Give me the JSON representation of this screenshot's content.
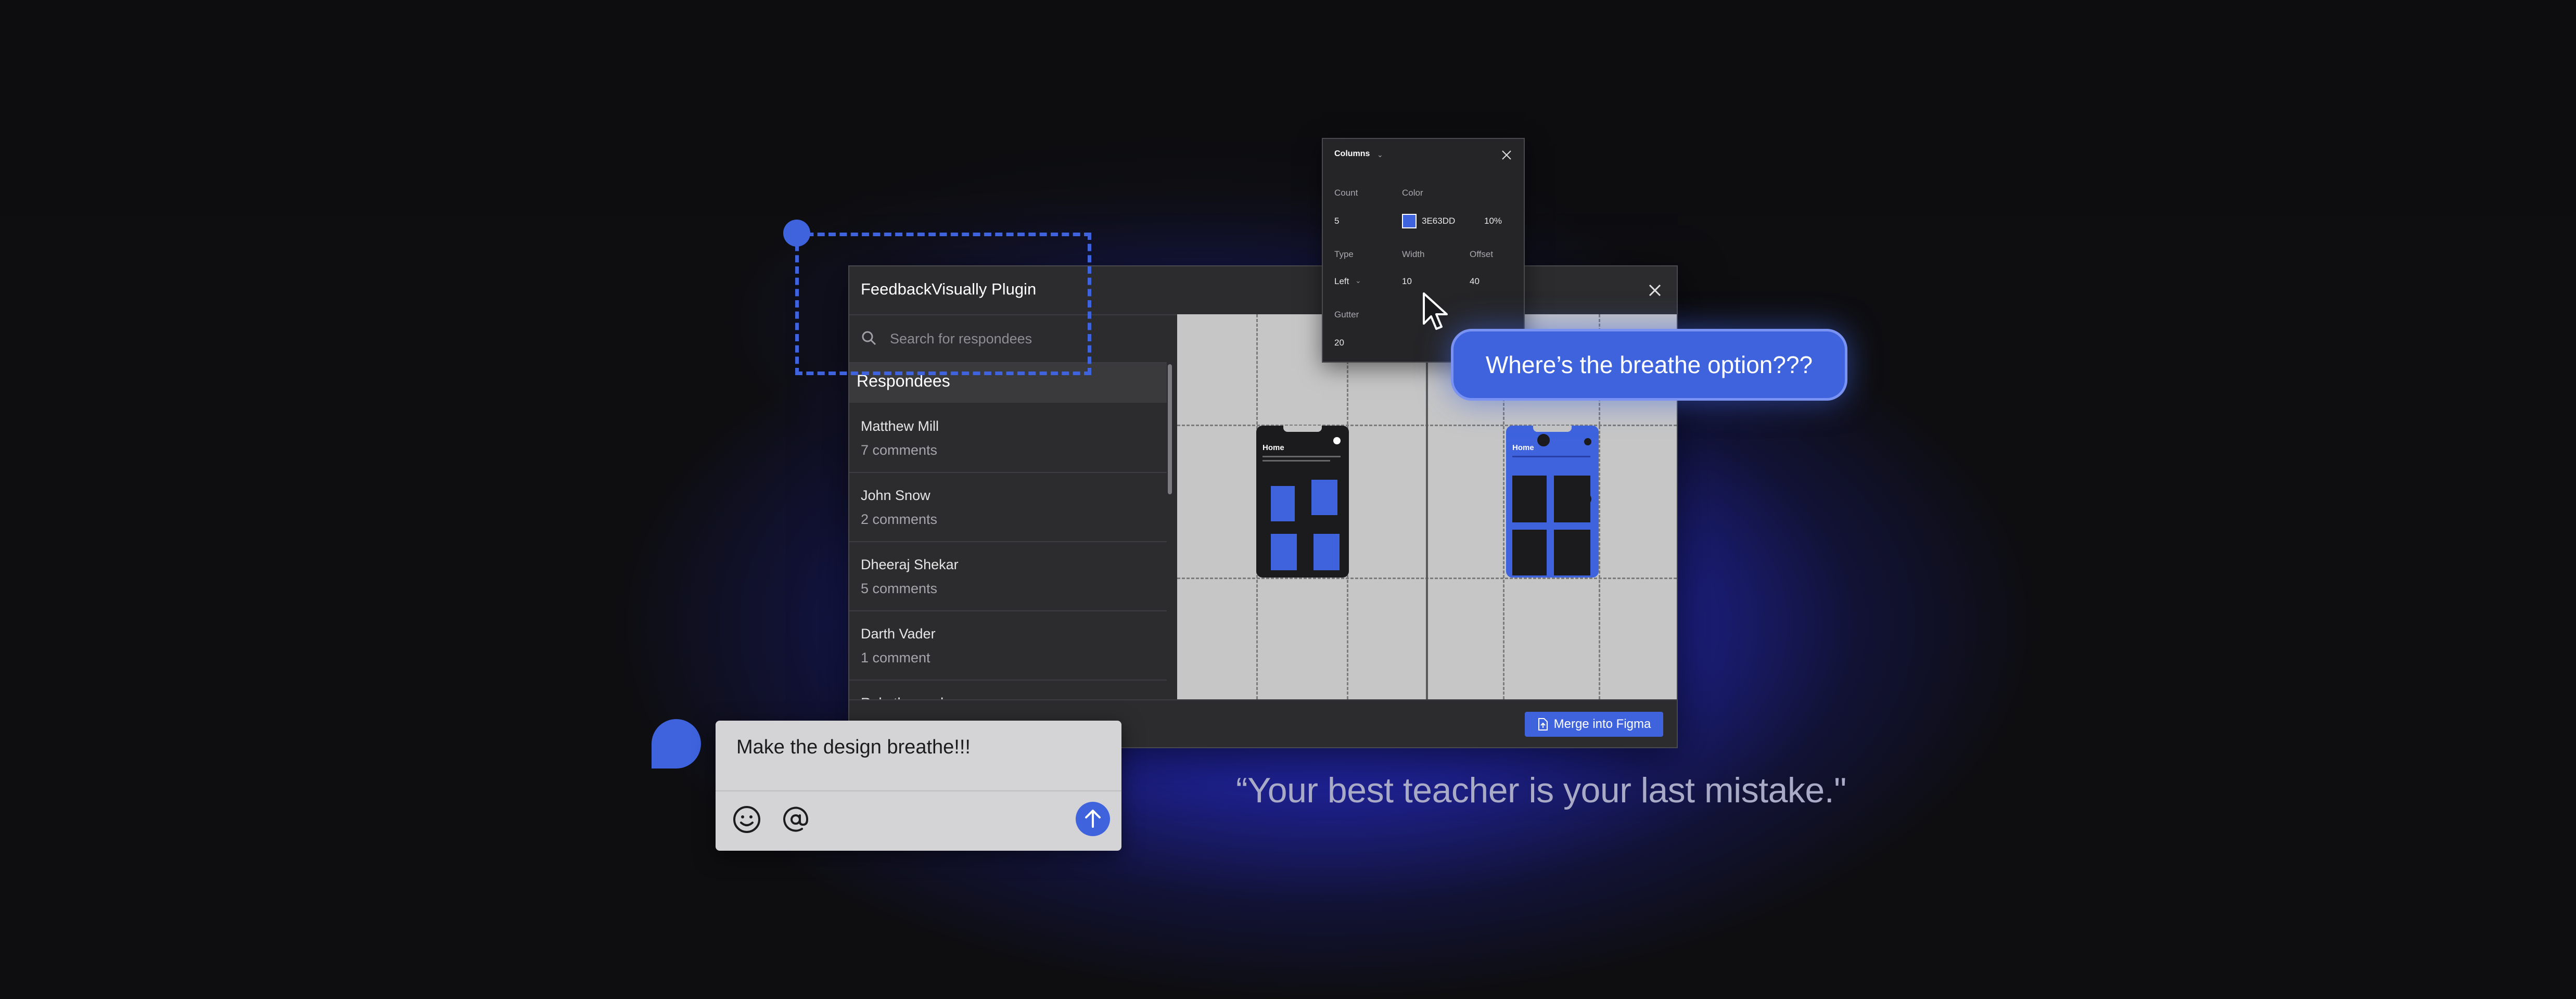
{
  "plugin": {
    "title": "FeedbackVisually Plugin",
    "close_icon": "close-icon",
    "search": {
      "placeholder": "Search for respondees",
      "icon": "search-icon"
    },
    "respondees_heading": "Respondees",
    "respondees": [
      {
        "name": "Matthew Mill",
        "comments": "7 comments"
      },
      {
        "name": "John Snow",
        "comments": "2 comments"
      },
      {
        "name": "Dheeraj Shekar",
        "comments": "5 comments"
      },
      {
        "name": "Darth Vader",
        "comments": "1 comment"
      },
      {
        "name": "Rakotho... ...k...",
        "comments": ""
      }
    ],
    "phones": [
      {
        "title": "Home"
      },
      {
        "title": "Home"
      }
    ],
    "merge_button": "Merge into Figma"
  },
  "columns_popover": {
    "title": "Columns",
    "count_label": "Count",
    "count_value": "5",
    "color_label": "Color",
    "color_hex": "3E63DD",
    "color_opacity": "10%",
    "type_label": "Type",
    "type_value": "Left",
    "width_label": "Width",
    "width_value": "10",
    "offset_label": "Offset",
    "offset_value": "40",
    "gutter_label": "Gutter",
    "gutter_value": "20",
    "accent_color": "#3E63DD"
  },
  "tooltip_comment": "Where’s the breathe option???",
  "comment_box": {
    "text": "Make the design breathe!!!",
    "emoji_icon": "emoji-icon",
    "mention_icon": "at-icon",
    "send_icon": "arrow-up-icon"
  },
  "quote": "“Your best teacher is your last mistake.\""
}
